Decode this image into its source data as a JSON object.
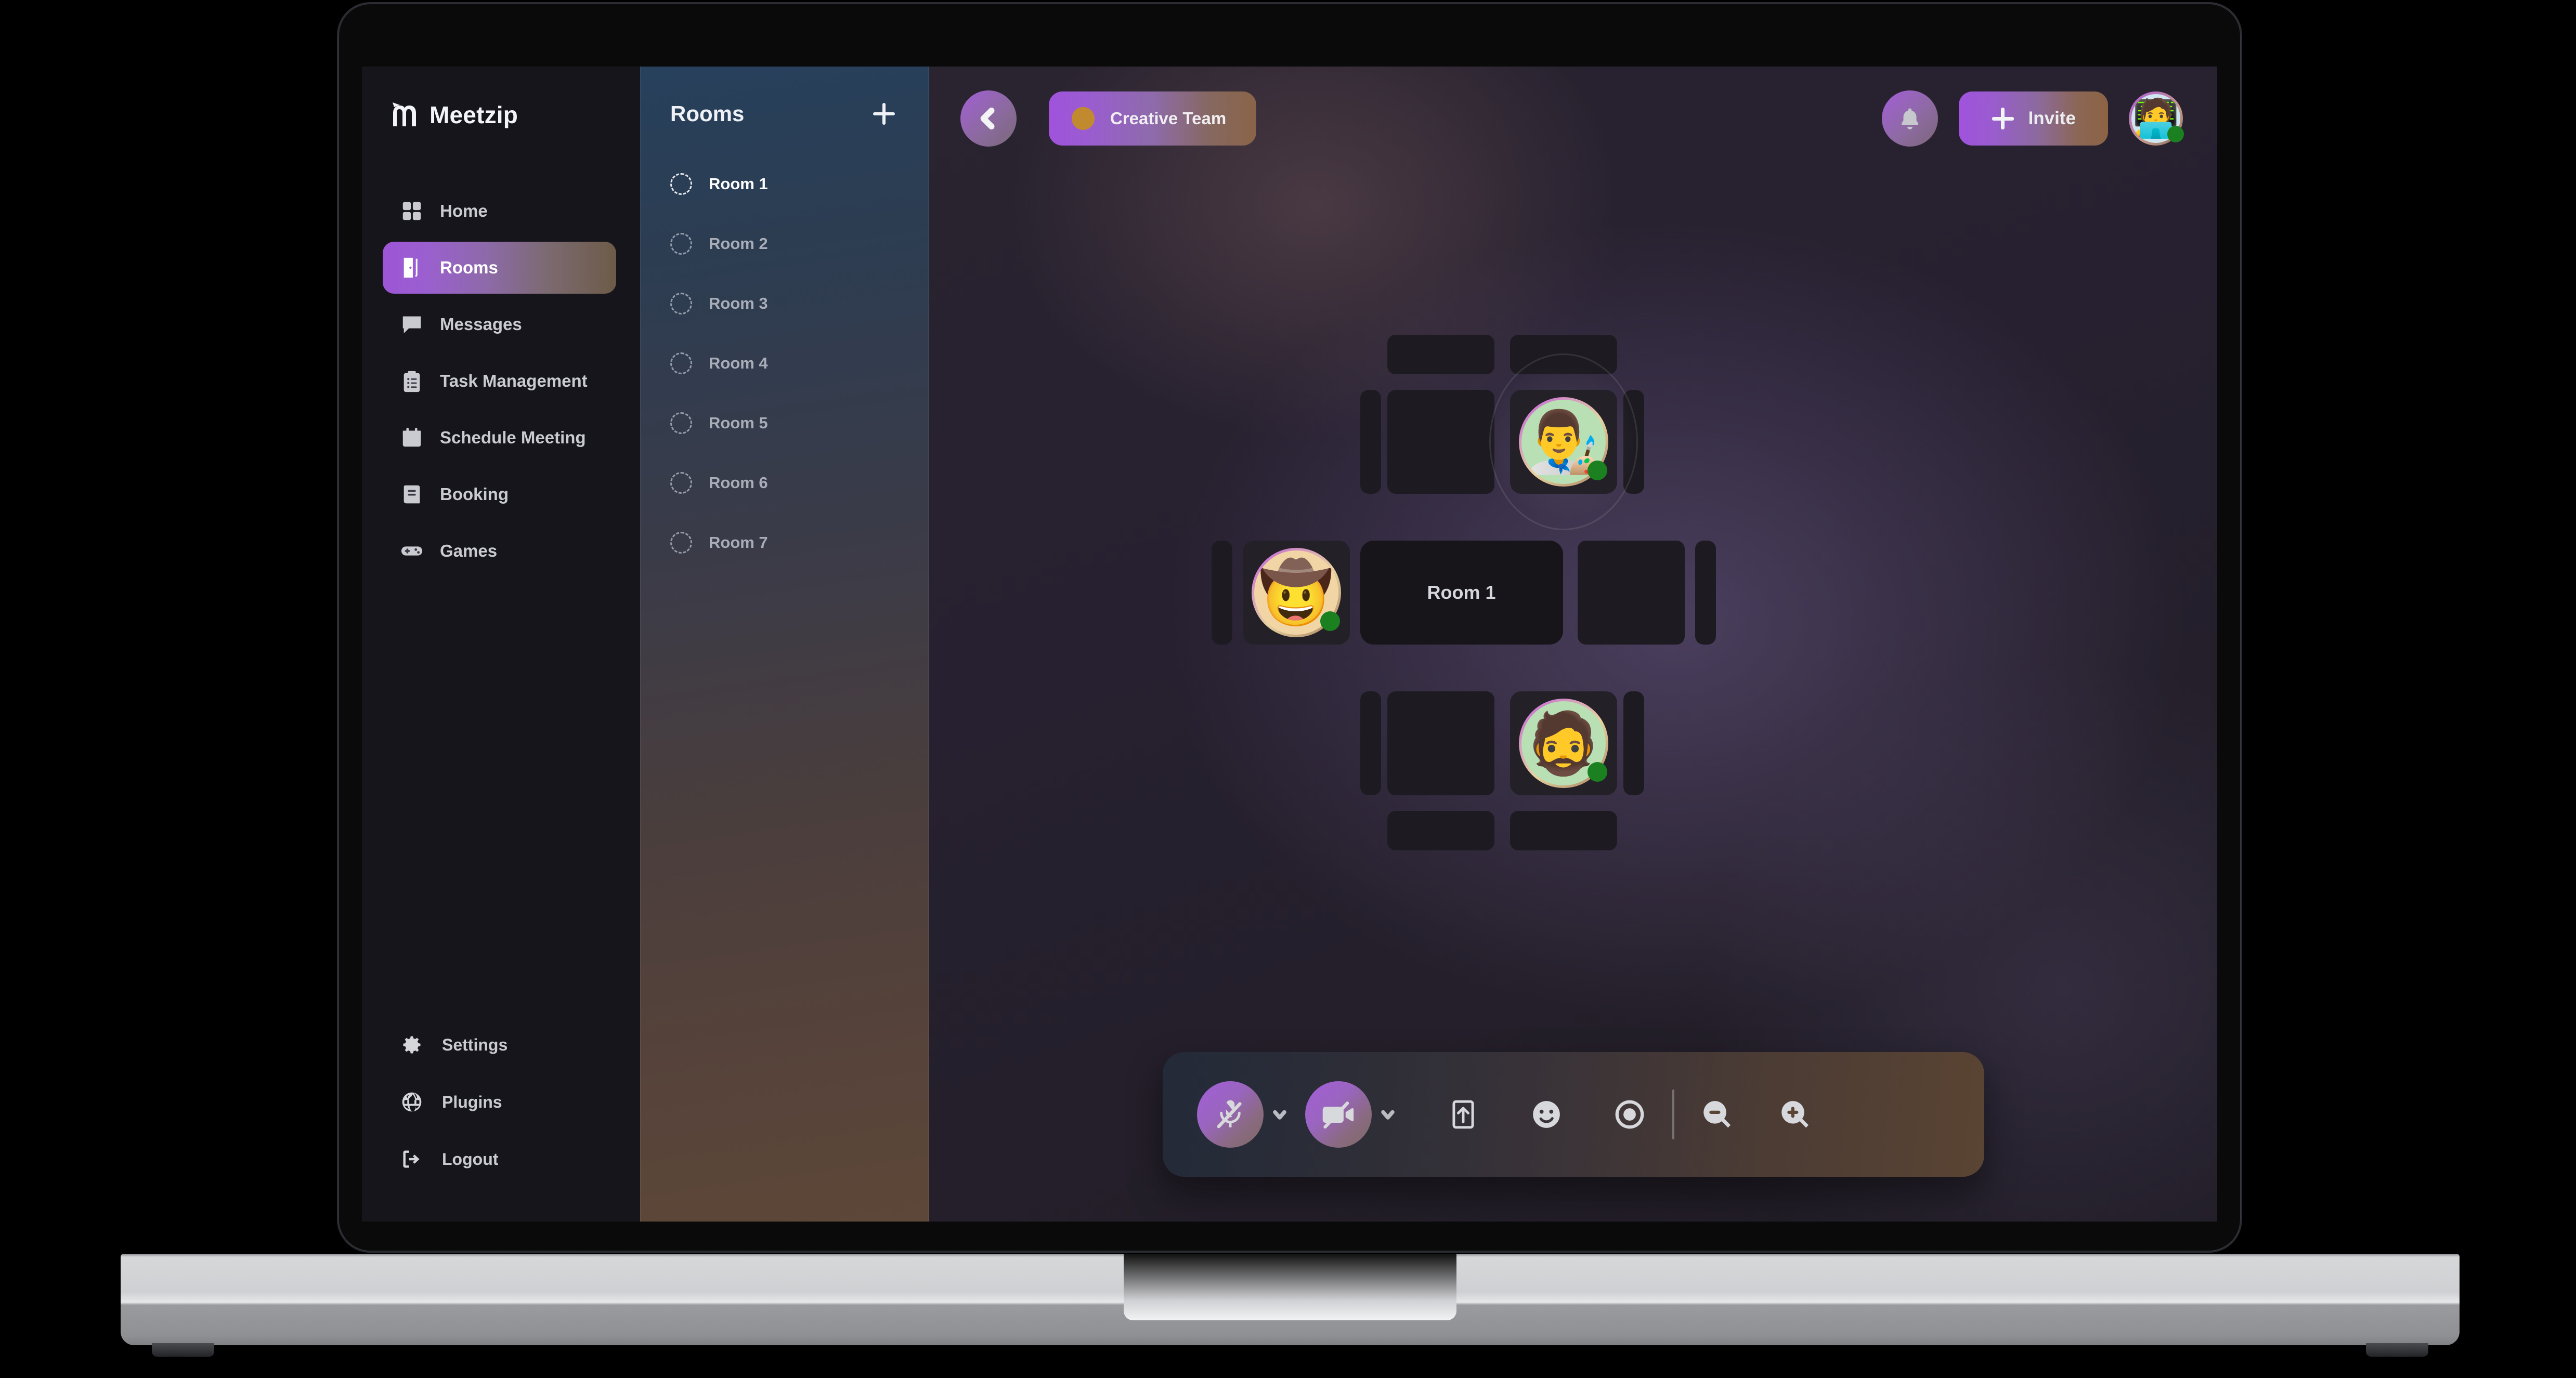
{
  "app": {
    "brand_name": "Meetzip",
    "logo_icon": "meetzip-m-logo"
  },
  "sidebar": {
    "nav_items": [
      {
        "label": "Home",
        "icon": "grid-icon",
        "active": false
      },
      {
        "label": "Rooms",
        "icon": "door-icon",
        "active": true
      },
      {
        "label": "Messages",
        "icon": "chat-bubble-icon",
        "active": false
      },
      {
        "label": "Task Management",
        "icon": "clipboard-list-icon",
        "active": false
      },
      {
        "label": "Schedule Meeting",
        "icon": "calendar-icon",
        "active": false
      },
      {
        "label": "Booking",
        "icon": "book-icon",
        "active": false
      },
      {
        "label": "Games",
        "icon": "gamepad-icon",
        "active": false
      }
    ],
    "bottom_items": [
      {
        "label": "Settings",
        "icon": "gear-icon"
      },
      {
        "label": "Plugins",
        "icon": "globe-icon"
      },
      {
        "label": "Logout",
        "icon": "logout-icon"
      }
    ],
    "active_accent_from": "#9d55d6",
    "active_accent_to": "#6d5b48"
  },
  "rooms_panel": {
    "title": "Rooms",
    "add_icon": "plus-icon",
    "rooms": [
      {
        "label": "Room 1",
        "active": true
      },
      {
        "label": "Room 2",
        "active": false
      },
      {
        "label": "Room 3",
        "active": false
      },
      {
        "label": "Room 4",
        "active": false
      },
      {
        "label": "Room 5",
        "active": false
      },
      {
        "label": "Room 6",
        "active": false
      },
      {
        "label": "Room 7",
        "active": false
      }
    ]
  },
  "topbar": {
    "back_icon": "chevron-left-icon",
    "team": {
      "name": "Creative Team",
      "dot_color": "#c28a2f"
    },
    "bell_icon": "bell-icon",
    "invite": {
      "label": "Invite",
      "icon": "plus-icon"
    },
    "me": {
      "avatar_emoji": "🧑‍💻",
      "status": "online",
      "status_color": "#1a8020"
    }
  },
  "stage": {
    "center_room_label": "Room 1",
    "participants": [
      {
        "seat": "top",
        "avatar_emoji": "👨‍🎨",
        "status": "online",
        "highlighted": true
      },
      {
        "seat": "left",
        "avatar_emoji": "🤠",
        "status": "online",
        "highlighted": false
      },
      {
        "seat": "bottom",
        "avatar_emoji": "🧔",
        "status": "online",
        "highlighted": false
      }
    ],
    "status_color": "#1a8020"
  },
  "controlbar": {
    "buttons": [
      {
        "name": "microphone-muted-button",
        "icon": "mic-off-icon",
        "state": "muted"
      },
      {
        "name": "mic-device-dropdown",
        "icon": "chevron-down-icon"
      },
      {
        "name": "camera-off-button",
        "icon": "video-off-icon",
        "state": "off"
      },
      {
        "name": "camera-device-dropdown",
        "icon": "chevron-down-icon"
      },
      {
        "name": "share-screen-button",
        "icon": "share-screen-icon"
      },
      {
        "name": "emoji-reaction-button",
        "icon": "smiley-icon"
      },
      {
        "name": "record-button",
        "icon": "record-circle-icon"
      },
      {
        "name": "zoom-out-button",
        "icon": "zoom-out-icon"
      },
      {
        "name": "zoom-in-button",
        "icon": "zoom-in-icon"
      }
    ]
  }
}
